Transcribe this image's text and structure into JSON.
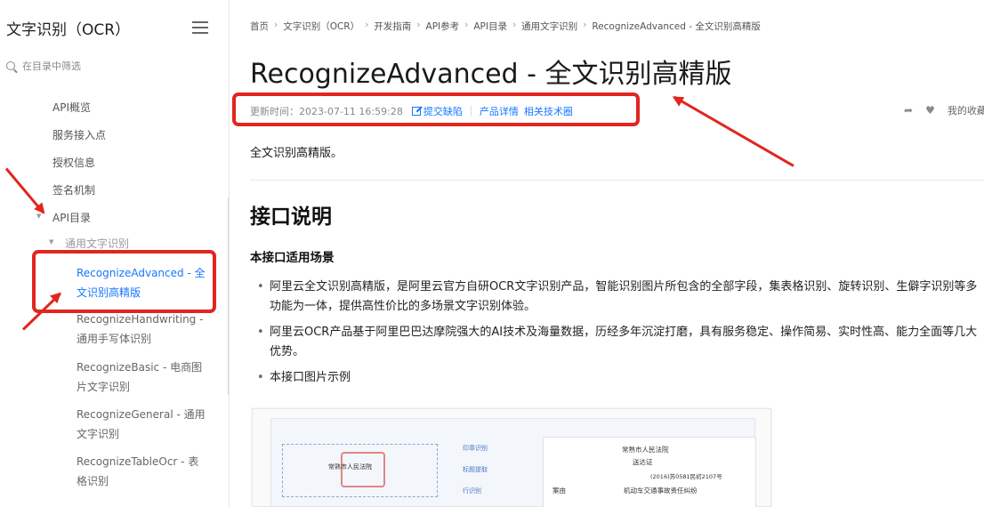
{
  "sidebar": {
    "title": "文字识别（OCR）",
    "search_placeholder": "在目录中筛选",
    "items": [
      {
        "label": "API概览"
      },
      {
        "label": "服务接入点"
      },
      {
        "label": "授权信息"
      },
      {
        "label": "签名机制"
      },
      {
        "label": "API目录"
      },
      {
        "label": "通用文字识别"
      }
    ],
    "subitems": [
      {
        "label": "RecognizeAdvanced - 全文识别高精版",
        "active": true
      },
      {
        "label": "RecognizeHandwriting - 通用手写体识别"
      },
      {
        "label": "RecognizeBasic - 电商图片文字识别"
      },
      {
        "label": "RecognizeGeneral - 通用文字识别"
      },
      {
        "label": "RecognizeTableOcr - 表格识别"
      }
    ]
  },
  "breadcrumb": [
    "首页",
    "文字识别（OCR）",
    "开发指南",
    "API参考",
    "API目录",
    "通用文字识别",
    "RecognizeAdvanced - 全文识别高精版"
  ],
  "page": {
    "title": "RecognizeAdvanced - 全文识别高精版",
    "meta": {
      "updated": "更新时间：2023-07-11 16:59:28",
      "report_bug": "提交缺陷",
      "product_detail": "产品详情",
      "tech_circle": "相关技术圈"
    },
    "right_tools": {
      "favorites": "我的收藏"
    },
    "lead": "全文识别高精版。",
    "section_title": "接口说明",
    "subsection_title": "本接口适用场景",
    "bullets": [
      "阿里云全文识别高精版，是阿里云官方自研OCR文字识别产品，智能识别图片所包含的全部字段，集表格识别、旋转识别、生僻字识别等多功能为一体，提供高性价比的多场景文字识别体验。",
      "阿里云OCR产品基于阿里巴巴达摩院强大的AI技术及海量数据，历经多年沉淀打磨，具有服务稳定、操作简易、实时性高、能力全面等几大优势。",
      "本接口图片示例"
    ]
  },
  "example_image": {
    "labels": [
      "印章识别",
      "标题提取",
      "行识别"
    ],
    "doc_title": "常熟市人民法院",
    "doc_subtitle": "送达证",
    "doc_number": "(2016)苏0581民初2107号",
    "doc_field": "案由",
    "doc_value": "机动车交通事故责任纠纷"
  },
  "colors": {
    "accent": "#1677ff",
    "annotation": "#e0261f"
  }
}
